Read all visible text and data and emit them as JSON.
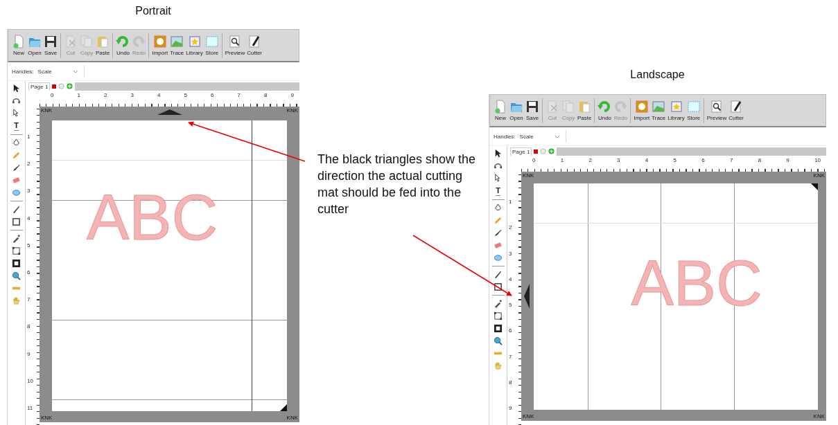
{
  "panels": [
    {
      "title": "Portrait",
      "kind": "portrait",
      "toolbar": [
        [
          {
            "kind": "new",
            "label": "New",
            "disabled": false
          },
          {
            "kind": "open",
            "label": "Open",
            "disabled": false
          },
          {
            "kind": "save",
            "label": "Save",
            "disabled": false
          }
        ],
        [
          {
            "kind": "cut",
            "label": "Cut",
            "disabled": true
          },
          {
            "kind": "copy",
            "label": "Copy",
            "disabled": true
          },
          {
            "kind": "paste",
            "label": "Paste",
            "disabled": false
          }
        ],
        [
          {
            "kind": "undo",
            "label": "Undo",
            "disabled": false
          },
          {
            "kind": "redo",
            "label": "Redo",
            "disabled": true
          }
        ],
        [
          {
            "kind": "import",
            "label": "Import",
            "disabled": false
          },
          {
            "kind": "trace",
            "label": "Trace",
            "disabled": false
          },
          {
            "kind": "library",
            "label": "Library",
            "disabled": false
          },
          {
            "kind": "store",
            "label": "Store",
            "disabled": false
          }
        ],
        [
          {
            "kind": "preview",
            "label": "Preview",
            "disabled": false
          },
          {
            "kind": "cutter",
            "label": "Cutter",
            "disabled": false
          }
        ]
      ],
      "handles": {
        "label": "Handles:",
        "value": "Scale"
      },
      "page_tab": "Page 1",
      "tools": [
        {
          "kind": "pointer"
        },
        {
          "kind": "node"
        },
        {
          "kind": "reshape"
        },
        {
          "kind": "text",
          "glyph": "T"
        },
        {
          "kind": "separator"
        },
        {
          "kind": "pen"
        },
        {
          "kind": "pencil"
        },
        {
          "kind": "brush"
        },
        {
          "kind": "eraser"
        },
        {
          "kind": "ellipse"
        },
        {
          "kind": "separator"
        },
        {
          "kind": "knife"
        },
        {
          "kind": "rectangle"
        },
        {
          "kind": "separator"
        },
        {
          "kind": "eyedropper"
        },
        {
          "kind": "path"
        },
        {
          "kind": "fit"
        },
        {
          "kind": "zoom"
        },
        {
          "kind": "ruler"
        },
        {
          "kind": "hand"
        }
      ],
      "top_ruler": [
        "0",
        "1",
        "2",
        "3",
        "4",
        "5",
        "6",
        "7",
        "8",
        "9"
      ],
      "side_ruler": [
        "1",
        "2",
        "3",
        "4",
        "5",
        "6",
        "7",
        "8",
        "9",
        "10",
        "11"
      ],
      "mat_labels": [
        "KNK",
        "KNK",
        "KNK",
        "KNK"
      ],
      "design_text": "ABC"
    },
    {
      "title": "Landscape",
      "kind": "landscape",
      "toolbar": [
        [
          {
            "kind": "new",
            "label": "New",
            "disabled": false
          },
          {
            "kind": "open",
            "label": "Open",
            "disabled": false
          },
          {
            "kind": "save",
            "label": "Save",
            "disabled": false
          }
        ],
        [
          {
            "kind": "cut",
            "label": "Cut",
            "disabled": true
          },
          {
            "kind": "copy",
            "label": "Copy",
            "disabled": true
          },
          {
            "kind": "paste",
            "label": "Paste",
            "disabled": false
          }
        ],
        [
          {
            "kind": "undo",
            "label": "Undo",
            "disabled": false
          },
          {
            "kind": "redo",
            "label": "Redo",
            "disabled": true
          }
        ],
        [
          {
            "kind": "import",
            "label": "Import",
            "disabled": false
          },
          {
            "kind": "trace",
            "label": "Trace",
            "disabled": false
          },
          {
            "kind": "library",
            "label": "Library",
            "disabled": false
          },
          {
            "kind": "store",
            "label": "Store",
            "disabled": false
          }
        ],
        [
          {
            "kind": "preview",
            "label": "Preview",
            "disabled": false
          },
          {
            "kind": "cutter",
            "label": "Cutter",
            "disabled": false
          }
        ]
      ],
      "handles": {
        "label": "Handles:",
        "value": "Scale"
      },
      "page_tab": "Page 1",
      "tools": [
        {
          "kind": "pointer"
        },
        {
          "kind": "node"
        },
        {
          "kind": "reshape"
        },
        {
          "kind": "text",
          "glyph": "T"
        },
        {
          "kind": "separator"
        },
        {
          "kind": "pen"
        },
        {
          "kind": "pencil"
        },
        {
          "kind": "brush"
        },
        {
          "kind": "eraser"
        },
        {
          "kind": "ellipse"
        },
        {
          "kind": "separator"
        },
        {
          "kind": "knife"
        },
        {
          "kind": "rectangle"
        },
        {
          "kind": "separator"
        },
        {
          "kind": "eyedropper"
        },
        {
          "kind": "path"
        },
        {
          "kind": "fit"
        },
        {
          "kind": "zoom"
        },
        {
          "kind": "ruler"
        },
        {
          "kind": "hand"
        }
      ],
      "top_ruler": [
        "0",
        "1",
        "2",
        "3",
        "4",
        "5",
        "6",
        "7",
        "8",
        "9",
        "10"
      ],
      "side_ruler": [
        "1",
        "2",
        "3",
        "4",
        "5",
        "6",
        "7",
        "8",
        "9"
      ],
      "mat_labels": [
        "KNK",
        "KNK",
        "KNK",
        "KNK"
      ],
      "design_text": "ABC"
    }
  ],
  "annotation": "The black triangles show the direction the actual cutting mat should be fed into the cutter"
}
